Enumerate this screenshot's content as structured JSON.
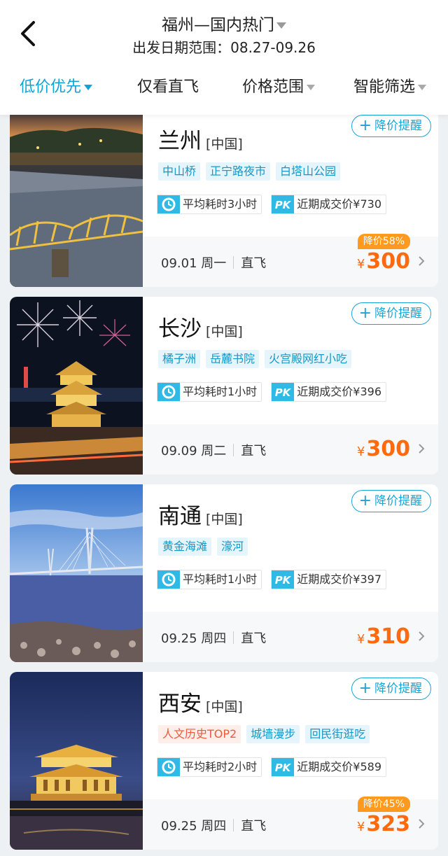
{
  "header": {
    "title": "福州—国内热门",
    "subtitle": "出发日期范围：08.27-09.26"
  },
  "filters": [
    {
      "label": "低价优先",
      "active": true
    },
    {
      "label": "仅看直飞"
    },
    {
      "label": "价格范围"
    },
    {
      "label": "智能筛选"
    }
  ],
  "cards": [
    {
      "city": "兰州",
      "country": "[中国]",
      "alert": "降价提醒",
      "tags": [
        "中山桥",
        "正宁路夜市",
        "白塔山公园"
      ],
      "duration": "平均耗时3小时",
      "recent": "近期成交价¥730",
      "date": "09.01 周一",
      "direct": "直飞",
      "yen": "¥",
      "price": "300",
      "badge": "降价58%"
    },
    {
      "city": "长沙",
      "country": "[中国]",
      "alert": "降价提醒",
      "tags": [
        "橘子洲",
        "岳麓书院",
        "火宫殿网红小吃"
      ],
      "duration": "平均耗时1小时",
      "recent": "近期成交价¥396",
      "date": "09.09 周二",
      "direct": "直飞",
      "yen": "¥",
      "price": "300"
    },
    {
      "city": "南通",
      "country": "[中国]",
      "alert": "降价提醒",
      "tags": [
        "黄金海滩",
        "濠河"
      ],
      "duration": "平均耗时1小时",
      "recent": "近期成交价¥397",
      "date": "09.25 周四",
      "direct": "直飞",
      "yen": "¥",
      "price": "310"
    },
    {
      "city": "西安",
      "country": "[中国]",
      "alert": "降价提醒",
      "hot_tag": "人文历史TOP2",
      "tags": [
        "城墙漫步",
        "回民街逛吃"
      ],
      "duration": "平均耗时2小时",
      "recent": "近期成交价¥589",
      "date": "09.25 周四",
      "direct": "直飞",
      "yen": "¥",
      "price": "323",
      "badge": "降价45%"
    }
  ],
  "icons": {
    "back": "chevron-left-icon",
    "clock": "clock-icon",
    "pk": "pk-icon",
    "pk_text": "PK",
    "next": "chevron-right-icon"
  },
  "colors": {
    "accent": "#10a3d6",
    "price": "#ff6a0e",
    "badge": "#ff9a1e",
    "hot_tag": "#ee5a3d"
  }
}
